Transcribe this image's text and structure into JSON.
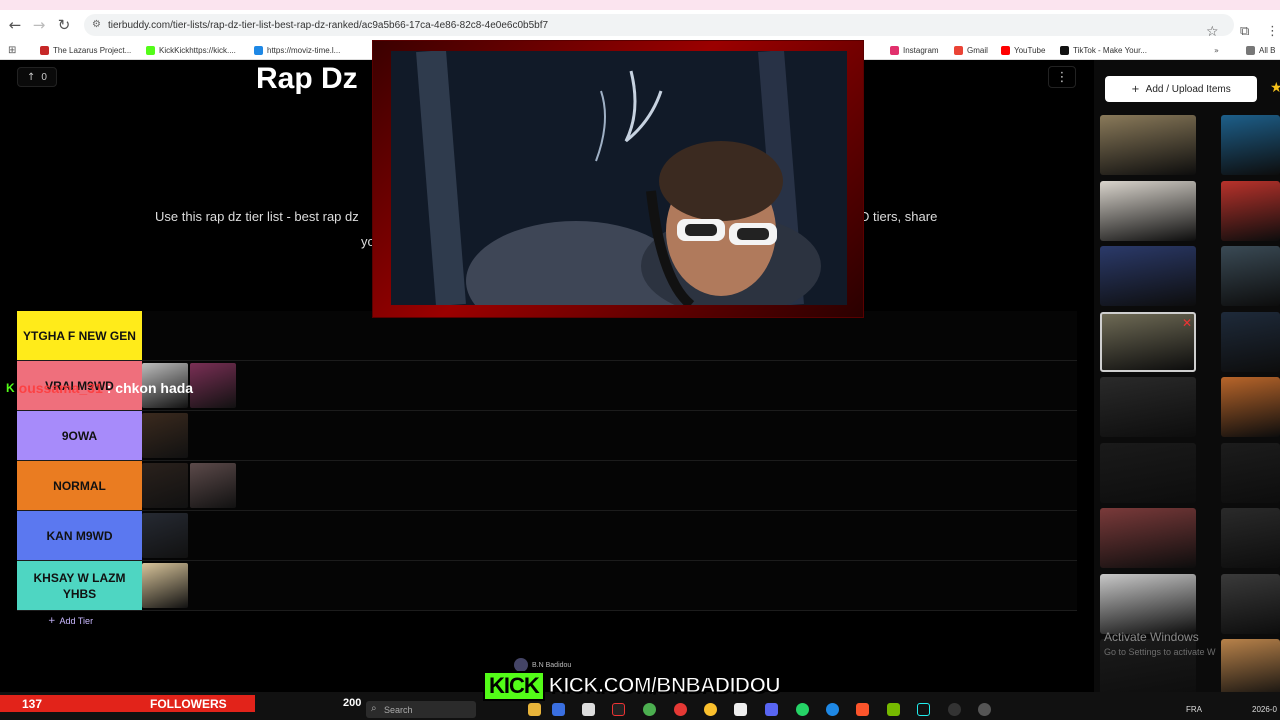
{
  "browser": {
    "url": "tierbuddy.com/tier-lists/rap-dz-tier-list-best-rap-dz-ranked/ac9a5b66-17ca-4e86-82c8-4e0e6c0b5bf7",
    "bookmarks": [
      {
        "label": "The Lazarus Project...",
        "color": "#c62828"
      },
      {
        "label": "KickKickhttps://kick....",
        "color": "#53fc18"
      },
      {
        "label": "https://moviz-time.l...",
        "color": "#1e88e5"
      },
      {
        "label": "Instagram",
        "color": "#e1306c"
      },
      {
        "label": "Gmail",
        "color": "#ea4335"
      },
      {
        "label": "YouTube",
        "color": "#ff0000"
      },
      {
        "label": "TikTok - Make Your...",
        "color": "#111111"
      },
      {
        "label": "All B",
        "color": "#777777"
      }
    ]
  },
  "page": {
    "title": "Rap Dz",
    "upvotes": "0",
    "description_part1": "Use this rap dz tier list - best rap dz",
    "description_part2": "D tiers, share",
    "description_part3": "yo",
    "add_tier_label": "Add Tier"
  },
  "tiers": [
    {
      "label": "YTGHA F NEW GEN",
      "color": "#ffeb1a",
      "items": []
    },
    {
      "label": "VRAI M9WD",
      "color": "#ef6f7c",
      "items": [
        "#bdbdbd",
        "#7a2f55"
      ]
    },
    {
      "label": "9OWA",
      "color": "#a78bfa",
      "items": [
        "#3b2a1e"
      ]
    },
    {
      "label": "NORMAL",
      "color": "#ea7c21",
      "items": [
        "#2a211c",
        "#5c4a4a"
      ]
    },
    {
      "label": "KAN M9WD",
      "color": "#5b78f0",
      "items": [
        "#262a33"
      ]
    },
    {
      "label": "KHSAY W LAZM YHBS",
      "color": "#4ed6c2",
      "items": [
        "#d8c49a"
      ]
    }
  ],
  "chat": {
    "username": "oussama_31",
    "message": ": chkon hada"
  },
  "sidebar": {
    "upload_label": "Add / Upload Items",
    "items_col1": [
      "#8a7a5a",
      "#d9d4cc",
      "#2b3a6a",
      "#6e6a55",
      "#2a2a2a",
      "#1a1a1a",
      "#7a3a3a",
      "#c8c8c8",
      "#1b1b1b"
    ],
    "items_col2": [
      "#1d5f8a",
      "#b8322b",
      "#3a4a55",
      "#1e2a3a",
      "#b8652a",
      "#1c1c1c",
      "#2a2a2a",
      "#3a3a3a",
      "#b8824a"
    ],
    "activate_title": "Activate Windows",
    "activate_sub": "Go to Settings to activate W"
  },
  "stream": {
    "followers_count": "137",
    "followers_label": "FOLLOWERS",
    "kick_logo": "KICK",
    "kick_url": "KICK.COM/BNBADIDOU",
    "streamer_name": "B.N Badidou",
    "viewer_count": "200"
  },
  "taskbar": {
    "search_placeholder": "Search",
    "lang": "FRA",
    "date": "2026-0"
  }
}
